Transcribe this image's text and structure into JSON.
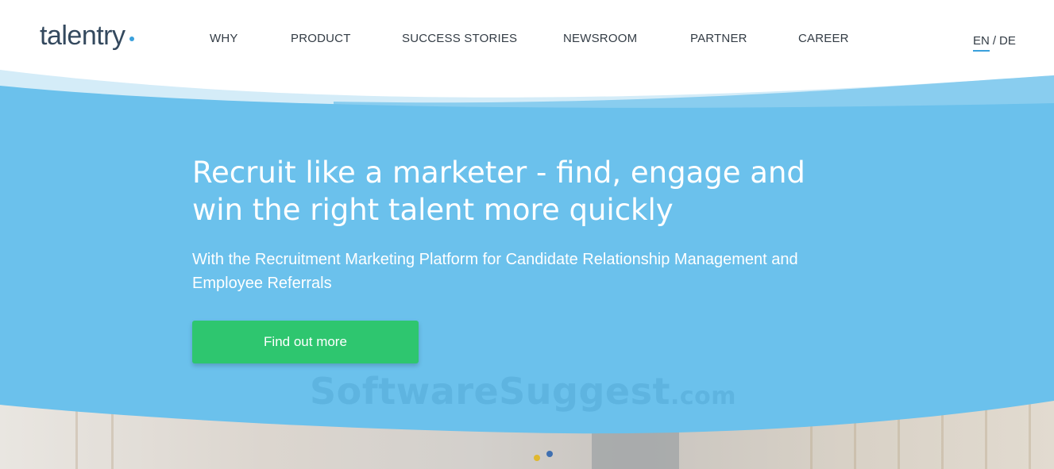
{
  "header": {
    "logo_text": "talentry",
    "nav": [
      {
        "label": "WHY"
      },
      {
        "label": "PRODUCT"
      },
      {
        "label": "SUCCESS STORIES"
      },
      {
        "label": "NEWSROOM"
      },
      {
        "label": "PARTNER"
      },
      {
        "label": "CAREER"
      }
    ],
    "lang": {
      "active": "EN",
      "separator": "/",
      "other": "DE"
    }
  },
  "hero": {
    "title_line1": "Recruit like a marketer - find, engage and",
    "title_line2": "win the right talent more quickly",
    "subtitle_line1": "With the Recruitment Marketing Platform for Candidate Relationship Management and",
    "subtitle_line2": "Employee Referrals",
    "cta_label": "Find out more"
  },
  "watermark": {
    "main": "SoftwareSuggest",
    "suffix": ".com"
  },
  "colors": {
    "hero_blue": "#6bc1ec",
    "wave_light": "#d4ecf8",
    "wave_mid": "#89cdef",
    "cta_green": "#2ec66f",
    "logo_dark": "#34495e",
    "accent": "#3aa0dc"
  }
}
